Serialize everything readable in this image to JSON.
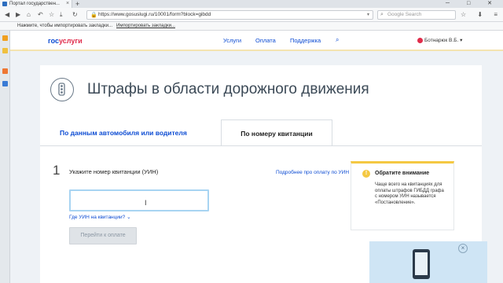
{
  "browser": {
    "tab_title": "Портал государствен...",
    "tab_close": "×",
    "new_tab": "+",
    "url": "https://www.gosuslugi.ru/10001/form?block=gibdd",
    "search_placeholder": "Google Search",
    "bookmarks_text": "Нажмите, чтобы импортировать закладки...",
    "bookmarks_link": "Импортировать закладки..."
  },
  "header": {
    "logo_part1": "гос",
    "logo_part2": "услуги",
    "nav": [
      "Услуги",
      "Оплата",
      "Поддержка"
    ],
    "user_name": "Ботнарюк В.Б."
  },
  "page": {
    "title": "Штрафы в области дорожного движения",
    "tabs": [
      "По данным автомобиля или водителя",
      "По номеру квитанции"
    ],
    "active_tab": 1,
    "step_number": "1",
    "step_label": "Укажите номер квитанции (УИН)",
    "pay_info_link": "Подробнее про оплату по УИН",
    "uin_value": "",
    "where_link": "Где УИН на квитанции?",
    "pay_button": "Перейти к оплате"
  },
  "notice": {
    "icon": "!",
    "title": "Обратите внимание",
    "text": "Чаще всего на квитанциях для оплаты штрафов ГИБДД графа с номером УИН называется «Постановление»."
  },
  "promo": {
    "close": "×"
  },
  "colors": {
    "accent": "#0d4cd3",
    "brand_red": "#e02c4b",
    "notice_yellow": "#f4c842"
  }
}
